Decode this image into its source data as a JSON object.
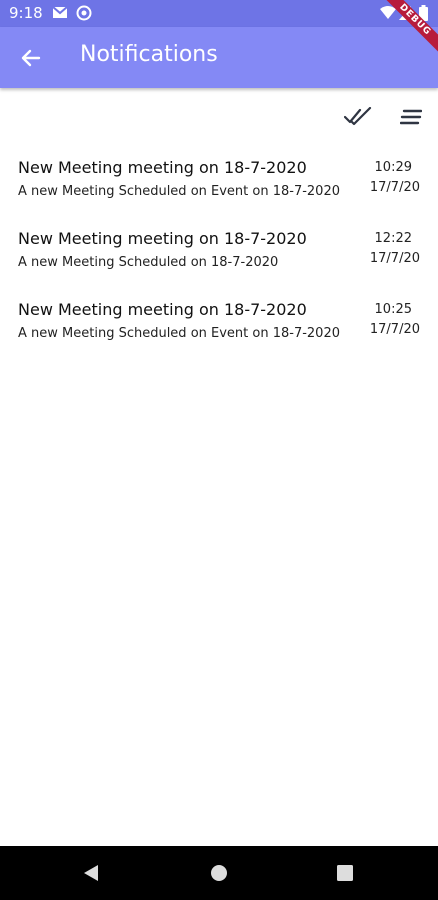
{
  "status_bar": {
    "time": "9:18"
  },
  "app_bar": {
    "title": "Notifications",
    "debug_banner": "DEBUG"
  },
  "actions": [
    "double-check-icon",
    "sort-icon"
  ],
  "notifications": [
    {
      "title": "New Meeting meeting on 18-7-2020",
      "body": "A new Meeting Scheduled on  Event on 18-7-2020",
      "time": "10:29",
      "date": "17/7/20"
    },
    {
      "title": "New Meeting meeting on 18-7-2020",
      "body": "A new Meeting Scheduled on 18-7-2020",
      "time": "12:22",
      "date": "17/7/20"
    },
    {
      "title": "New Meeting meeting on 18-7-2020",
      "body": "A new Meeting Scheduled on  Event on 18-7-2020",
      "time": "10:25",
      "date": "17/7/20"
    }
  ],
  "colors": {
    "status_bar": "#6e74e6",
    "app_bar": "#8489f5",
    "nav_bar": "#000000"
  }
}
